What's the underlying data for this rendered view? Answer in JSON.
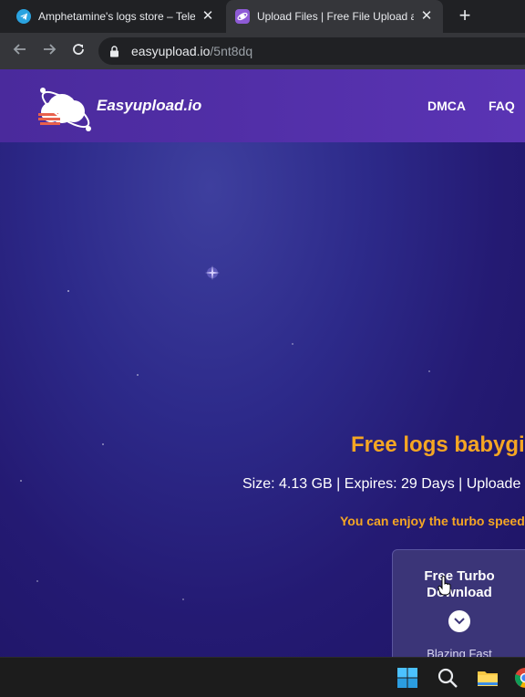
{
  "browser": {
    "tabs": [
      {
        "title": "Amphetamine's logs store – Tele",
        "favicon": "telegram-icon",
        "active": false
      },
      {
        "title": "Upload Files | Free File Upload a",
        "favicon": "easyupload-favicon",
        "active": true
      }
    ],
    "new_tab_label": "+",
    "close_label": "✕",
    "address": {
      "host": "easyupload.io",
      "path": "/5nt8dq"
    }
  },
  "site": {
    "brand": "Easyupload.io",
    "nav": [
      "DMCA",
      "FAQ"
    ],
    "colors": {
      "header": "#4a2a9c",
      "accent": "#f5a623",
      "background": "#241a73"
    }
  },
  "file": {
    "title": "Free logs babygi",
    "meta": "Size: 4.13 GB | Expires: 29 Days | Uploade",
    "turbo_note": "You can enjoy the turbo speed"
  },
  "download_card": {
    "title_line1": "Free Turbo",
    "title_line2": "Download",
    "subtitle": "Blazing Fast"
  },
  "taskbar": {
    "icons": [
      "windows-start-icon",
      "search-icon",
      "file-explorer-icon",
      "chrome-icon"
    ]
  }
}
